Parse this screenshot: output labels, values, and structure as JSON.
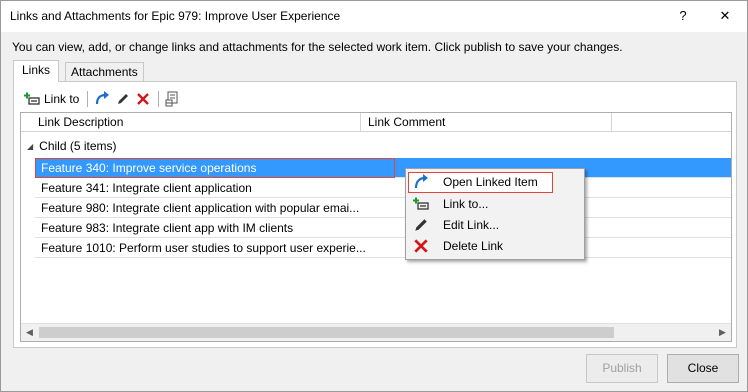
{
  "window": {
    "title": "Links and Attachments for Epic 979: Improve User Experience",
    "help_label": "?",
    "close_label": "✕"
  },
  "description": "You can view, add, or change links and attachments for the selected work item. Click publish to save your changes.",
  "tabs": [
    {
      "label": "Links",
      "active": true
    },
    {
      "label": "Attachments",
      "active": false
    }
  ],
  "toolbar": {
    "link_to_label": "Link to",
    "icons": [
      "add-link-icon",
      "open-linked-item-icon",
      "edit-icon",
      "delete-icon",
      "columns-icon"
    ]
  },
  "grid": {
    "columns": [
      "Link Description",
      "Link Comment"
    ],
    "group_label": "Child (5 items)",
    "rows": [
      {
        "description": "Feature 340: Improve service operations",
        "comment": "",
        "selected": true
      },
      {
        "description": "Feature 341: Integrate client application",
        "comment": ""
      },
      {
        "description": "Feature 980: Integrate client application with popular emai...",
        "comment": ""
      },
      {
        "description": "Feature 983: Integrate client app with IM clients",
        "comment": ""
      },
      {
        "description": "Feature 1010: Perform user studies to support user experie...",
        "comment": ""
      }
    ]
  },
  "context_menu": {
    "items": [
      {
        "label": "Open Linked Item",
        "icon": "open-linked-item-icon",
        "highlighted": true
      },
      {
        "label": "Link to...",
        "icon": "add-link-icon"
      },
      {
        "label": "Edit Link...",
        "icon": "edit-icon"
      },
      {
        "label": "Delete Link",
        "icon": "delete-icon"
      }
    ]
  },
  "buttons": {
    "publish_label": "Publish",
    "close_label": "Close"
  },
  "colors": {
    "selection": "#3399ff",
    "highlight_outline": "#e0463b",
    "delete_red": "#d01818",
    "link_blue": "#1e6fc8"
  }
}
